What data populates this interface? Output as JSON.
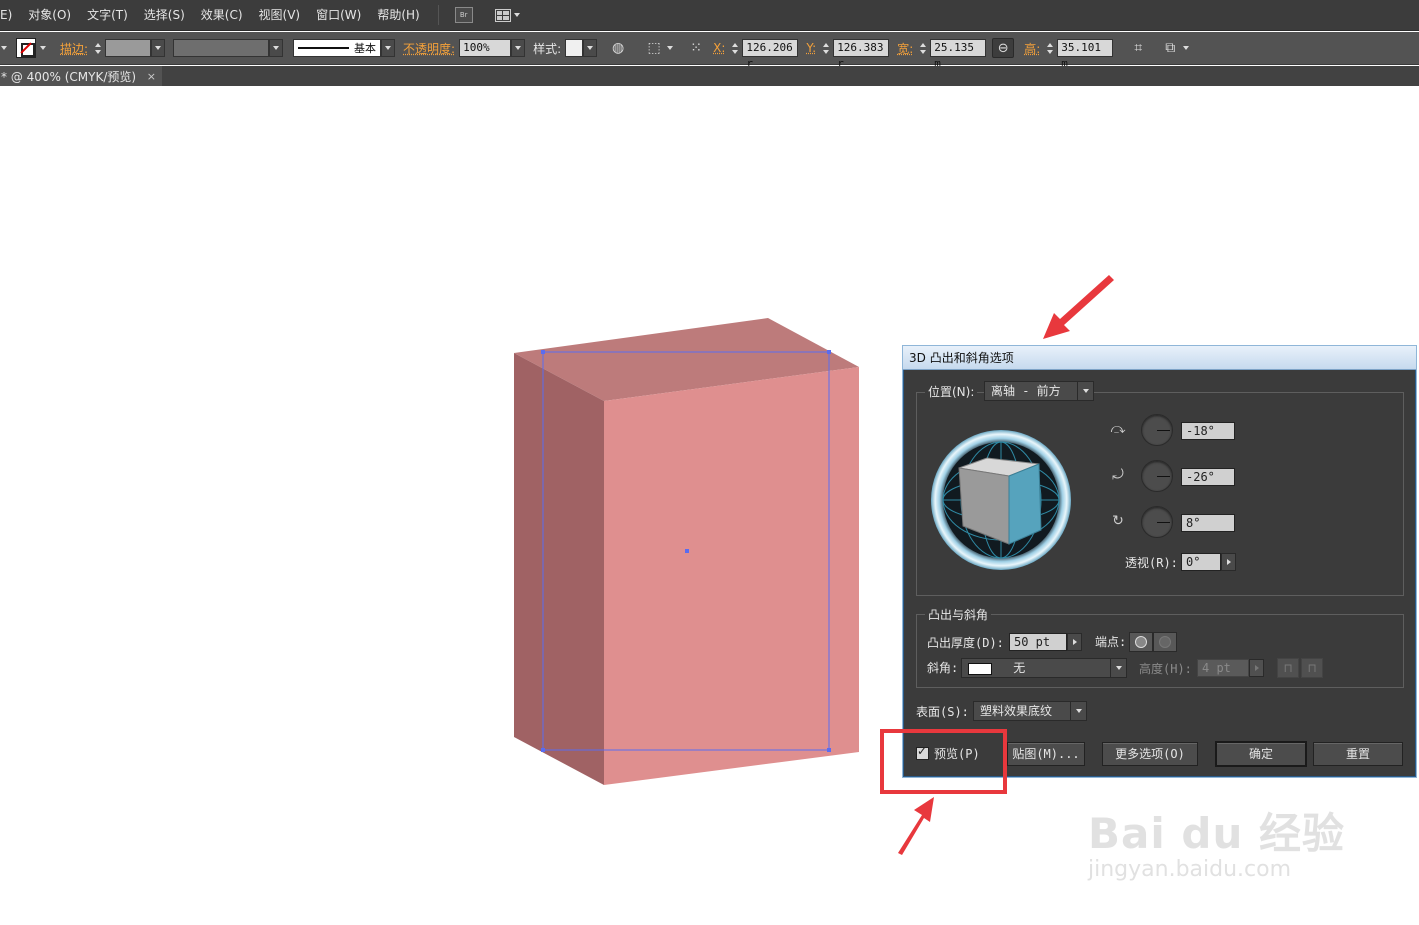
{
  "menu": {
    "items": [
      "E)",
      "对象(O)",
      "文字(T)",
      "选择(S)",
      "效果(C)",
      "视图(V)",
      "窗口(W)",
      "帮助(H)"
    ],
    "bridge_button": "Br"
  },
  "control_bar": {
    "stroke_label": "描边:",
    "line_style": "基本",
    "opacity_label": "不透明度:",
    "opacity_value": "100%",
    "style_label": "样式:",
    "x_label": "X:",
    "x_value": "126.206 r",
    "y_label": "Y:",
    "y_value": "126.383 r",
    "w_label": "宽:",
    "w_value": "25.135 m",
    "h_label": "高:",
    "h_value": "35.101 m"
  },
  "document_tab": {
    "title": "* @ 400% (CMYK/预览)",
    "close": "×"
  },
  "dialog": {
    "title": "3D 凸出和斜角选项",
    "position_label": "位置(N):",
    "position_value": "离轴 - 前方",
    "rot_x": "-18°",
    "rot_y": "-26°",
    "rot_z": "8°",
    "perspective_label": "透视(R):",
    "perspective_value": "0°",
    "extrude_group": "凸出与斜角",
    "depth_label": "凸出厚度(D):",
    "depth_value": "50 pt",
    "cap_label": "端点:",
    "bevel_label": "斜角:",
    "bevel_value": "无",
    "height_label": "高度(H):",
    "height_value": "4 pt",
    "surface_label": "表面(S):",
    "surface_value": "塑料效果底纹",
    "preview_label": "预览(P)",
    "preview_checked": true,
    "map_button": "贴图(M)...",
    "more_button": "更多选项(O)",
    "ok_button": "确定",
    "reset_button": "重置"
  },
  "artwork": {
    "front_color": "#df8f8f",
    "side_color": "#a06264",
    "top_color": "#bd7b7b",
    "selection_color": "#5a6cf0"
  },
  "annotation_color": "#e8383d",
  "watermark": {
    "brand": "Bai du 经验",
    "url": "jingyan.baidu.com"
  }
}
